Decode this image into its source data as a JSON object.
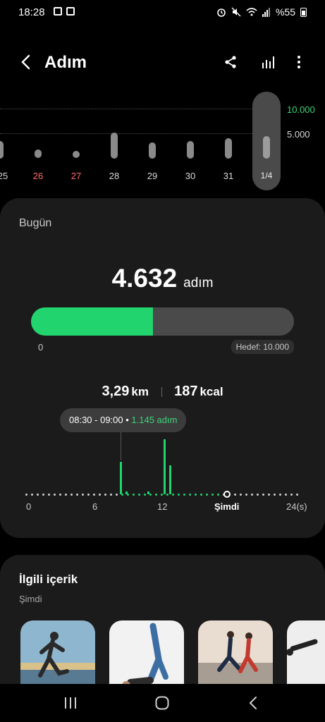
{
  "status_bar": {
    "time": "18:28",
    "battery": "%55",
    "icons": [
      "notes-icon",
      "box-icon",
      "alarm-icon",
      "mute-icon",
      "wifi-icon",
      "signal-icon",
      "battery-icon"
    ]
  },
  "header": {
    "title": "Adım",
    "actions": [
      "share-icon",
      "chart-icon",
      "more-icon"
    ]
  },
  "week_chart": {
    "goal_labels": [
      "10.000",
      "5.000"
    ],
    "goal_colors": [
      "#3ed67b",
      "#d9d9d9"
    ],
    "days": [
      {
        "label": "25",
        "color": "#d9d9d9"
      },
      {
        "label": "26",
        "color": "#ff6b6b"
      },
      {
        "label": "27",
        "color": "#ff6b6b"
      },
      {
        "label": "28",
        "color": "#d9d9d9"
      },
      {
        "label": "29",
        "color": "#d9d9d9"
      },
      {
        "label": "30",
        "color": "#d9d9d9"
      },
      {
        "label": "31",
        "color": "#d9d9d9"
      }
    ],
    "selected_label": "1/4"
  },
  "today": {
    "title": "Bugün",
    "steps": "4.632",
    "steps_unit": "adım",
    "progress_fraction": 0.4632,
    "progress_start": "0",
    "goal": "Hedef: 10.000",
    "distance": "3,29",
    "distance_unit": "km",
    "calories": "187",
    "calories_unit": "kcal",
    "tooltip_time": "08:30 - 09:00",
    "tooltip_value": "1.145 adım",
    "x_labels": [
      "0",
      "6",
      "12",
      "Şimdi",
      "24(s)"
    ]
  },
  "related": {
    "title": "İlgili içerik",
    "subtitle": "Şimdi"
  },
  "colors": {
    "accent_green": "#21d46d",
    "weekend_red": "#ff6b6b",
    "card_bg": "#1b1b1b"
  },
  "nav_bar": [
    "recents-icon",
    "home-icon",
    "back-icon"
  ]
}
